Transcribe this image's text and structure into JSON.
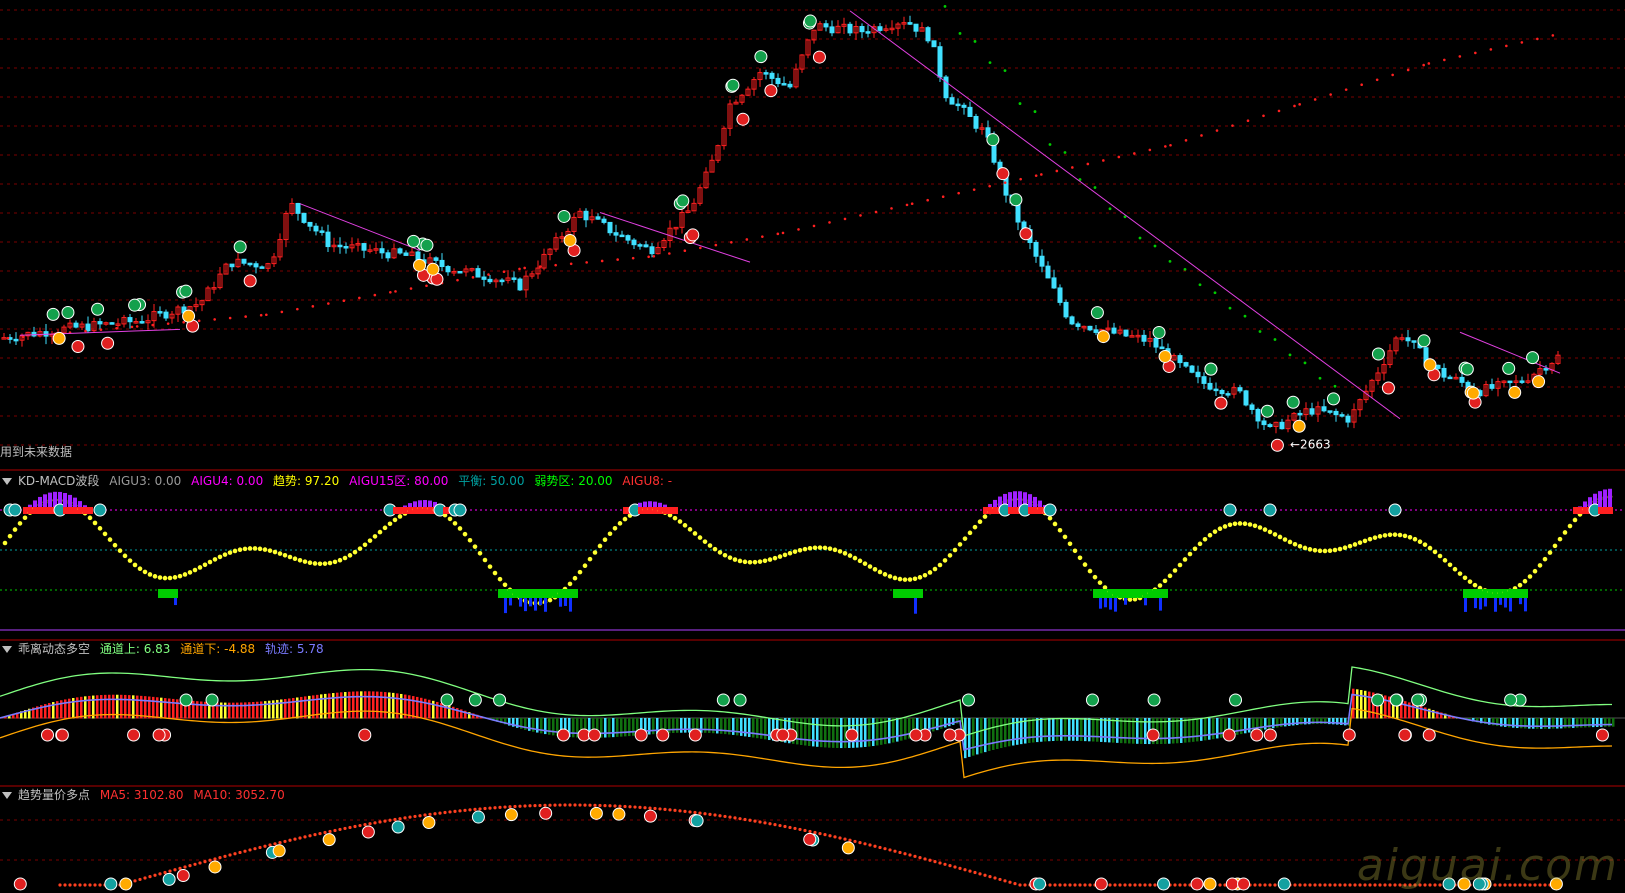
{
  "main_panel": {
    "note_text": "用到未来数据",
    "low_label": "2663"
  },
  "panels": [
    {
      "id": "kd",
      "title": "KD-MACD波段",
      "indicators": [
        {
          "label": "AIGU3:",
          "value": "0.00",
          "color": "#9a9a9a"
        },
        {
          "label": "AIGU4:",
          "value": "0.00",
          "color": "#ff00ff"
        },
        {
          "label": "趋势:",
          "value": "97.20",
          "color": "#ffff00"
        },
        {
          "label": "AIGU15区:",
          "value": "80.00",
          "color": "#ff00ff"
        },
        {
          "label": "平衡:",
          "value": "50.00",
          "color": "#00a0a0"
        },
        {
          "label": "弱势区:",
          "value": "20.00",
          "color": "#00ff00"
        },
        {
          "label": "AIGU8:",
          "value": "-",
          "color": "#ff3030"
        }
      ]
    },
    {
      "id": "bias",
      "title": "乖离动态多空",
      "indicators": [
        {
          "label": "通道上:",
          "value": "6.83",
          "color": "#80ff80"
        },
        {
          "label": "通道下:",
          "value": "-4.88",
          "color": "#ffa500"
        },
        {
          "label": "轨迹:",
          "value": "5.78",
          "color": "#7a7aff"
        }
      ]
    },
    {
      "id": "vol",
      "title": "趋势量价多点",
      "indicators": [
        {
          "label": "MA5:",
          "value": "3102.80",
          "color": "#ff3030"
        },
        {
          "label": "MA10:",
          "value": "3052.70",
          "color": "#ff3030"
        }
      ]
    }
  ],
  "watermark": "aiguai.com",
  "chart_data": {
    "type": "candlestick",
    "price_path": [
      [
        0,
        3000
      ],
      [
        60,
        3015
      ],
      [
        140,
        3030
      ],
      [
        200,
        3060
      ],
      [
        230,
        3130
      ],
      [
        270,
        3125
      ],
      [
        290,
        3230
      ],
      [
        330,
        3160
      ],
      [
        370,
        3150
      ],
      [
        410,
        3140
      ],
      [
        450,
        3120
      ],
      [
        490,
        3105
      ],
      [
        520,
        3090
      ],
      [
        545,
        3140
      ],
      [
        580,
        3215
      ],
      [
        620,
        3175
      ],
      [
        650,
        3150
      ],
      [
        690,
        3220
      ],
      [
        710,
        3290
      ],
      [
        730,
        3400
      ],
      [
        760,
        3455
      ],
      [
        790,
        3430
      ],
      [
        815,
        3535
      ],
      [
        860,
        3525
      ],
      [
        905,
        3545
      ],
      [
        930,
        3515
      ],
      [
        945,
        3420
      ],
      [
        985,
        3350
      ],
      [
        1010,
        3230
      ],
      [
        1040,
        3125
      ],
      [
        1070,
        3030
      ],
      [
        1110,
        3010
      ],
      [
        1150,
        2995
      ],
      [
        1200,
        2925
      ],
      [
        1240,
        2905
      ],
      [
        1270,
        2842
      ],
      [
        1310,
        2878
      ],
      [
        1350,
        2862
      ],
      [
        1380,
        2950
      ],
      [
        1400,
        3010
      ],
      [
        1440,
        2940
      ],
      [
        1480,
        2910
      ],
      [
        1520,
        2925
      ],
      [
        1558,
        2968
      ]
    ],
    "low_value": 2663,
    "series": [
      {
        "values": [
          3000,
          3020,
          3040,
          3080,
          3120,
          3140,
          3180,
          3230,
          3280,
          3330,
          3400,
          3470,
          3520,
          3545
        ]
      },
      {
        "values": [
          3530,
          3470,
          3420,
          3350,
          3280,
          3220,
          3170,
          3120,
          3080,
          3040,
          3000,
          2960,
          2920,
          2880
        ]
      }
    ],
    "kd_levels": [
      80,
      50,
      20
    ],
    "bias_values": {
      "upper": 6.83,
      "lower": -4.88,
      "track": 5.78
    },
    "volume_ma": {
      "MA5": 3102.8,
      "MA10": 3052.7
    },
    "colors": {
      "up": "#ff2020",
      "down": "#40e0ff",
      "purple": "#a020ff",
      "green": "#00cc00",
      "yellow": "#ffff30",
      "magenta": "#e040e0"
    }
  }
}
